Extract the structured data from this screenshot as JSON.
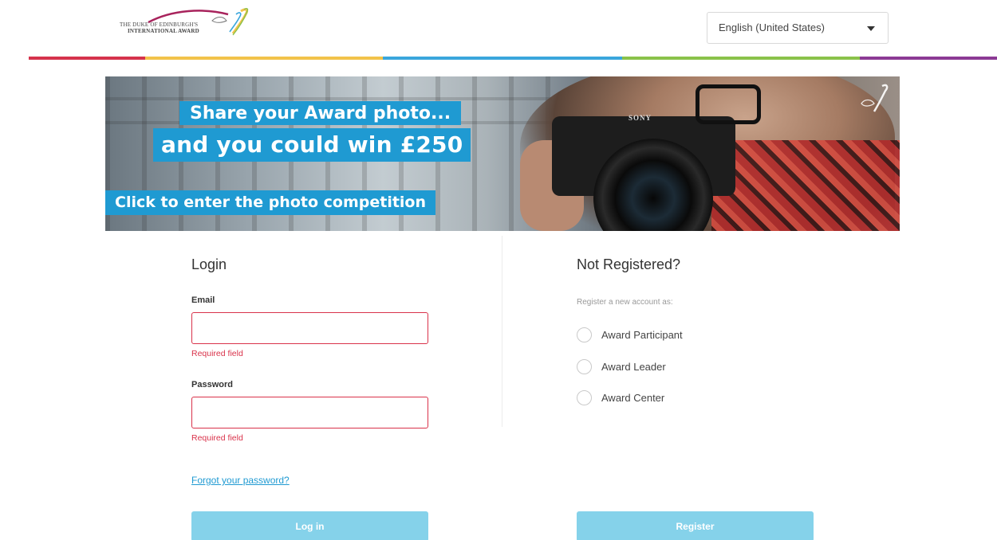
{
  "header": {
    "logo": {
      "line1": "THE DUKE OF EDINBURGH'S",
      "line2": "INTERNATIONAL AWARD"
    },
    "language": {
      "selected": "English (United States)"
    },
    "color_bar": [
      "#d5334c",
      "#f2c34a",
      "#3aa6dc",
      "#8ac24a",
      "#8c3b95"
    ]
  },
  "banner": {
    "headline_1": "Share your Award photo...",
    "headline_2": "and you could win £250",
    "cta": "Click to enter the photo competition",
    "camera_brand": "SONY",
    "accent": "#1f9ad2"
  },
  "login": {
    "title": "Login",
    "email_label": "Email",
    "email_value": "",
    "email_error": "Required field",
    "password_label": "Password",
    "password_value": "",
    "password_error": "Required field",
    "forgot_link": "Forgot your password?",
    "login_button": "Log in"
  },
  "register": {
    "title": "Not Registered?",
    "subtitle": "Register a new account as:",
    "options": [
      {
        "label": "Award Participant"
      },
      {
        "label": "Award Leader"
      },
      {
        "label": "Award Center"
      }
    ],
    "register_button": "Register"
  }
}
